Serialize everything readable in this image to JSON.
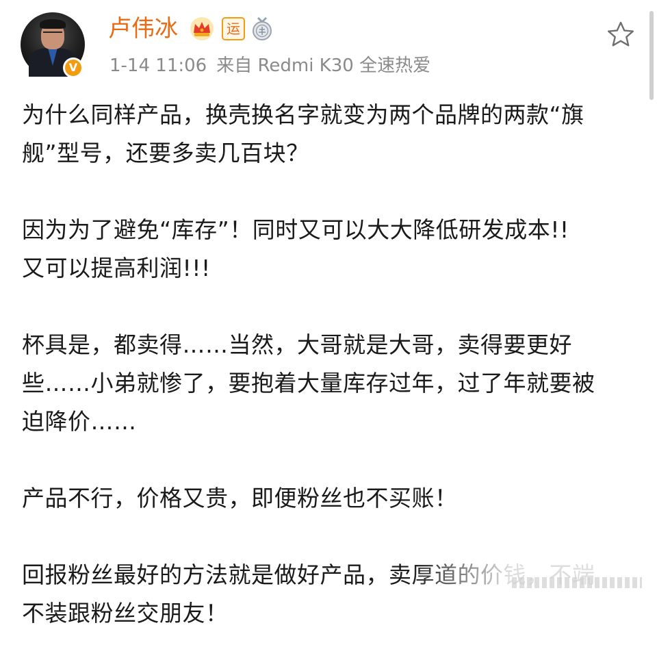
{
  "post": {
    "author": {
      "name": "卢伟冰",
      "verified_badge": "V",
      "badge_yun": "运",
      "avatar": "avatar-photo"
    },
    "meta": {
      "time": "1-14 11:06",
      "source": "来自 Redmi K30 全速热爱"
    },
    "icons": {
      "crown": "crown-icon",
      "medal": "medal-icon",
      "favorite": "star-icon"
    },
    "paragraphs": [
      {
        "lines": [
          "为什么同样产品，换壳换名字就变为两个品牌的两款“旗",
          "舰”型号，还要多卖几百块？"
        ]
      },
      {
        "lines": [
          "因为为了避免“库存”！同时又可以大大降低研发成本!!",
          "又可以提高利润!!!"
        ]
      },
      {
        "lines": [
          "杯具是，都卖得……当然，大哥就是大哥，卖得要更好",
          "些……小弟就惨了，要抱着大量库存过年，过了年就要被",
          "迫降价……"
        ]
      },
      {
        "lines": [
          "产品不行，价格又贵，即便粉丝也不买账！"
        ]
      },
      {
        "lines": [
          "回报粉丝最好的方法就是做好产品，卖厚道的价钱，不端",
          "不装跟粉丝交朋友！"
        ]
      }
    ],
    "colors": {
      "username": "#e86b16",
      "verified": "#f29d11",
      "meta": "#8a8a8a",
      "text": "#1a1a1a"
    }
  }
}
